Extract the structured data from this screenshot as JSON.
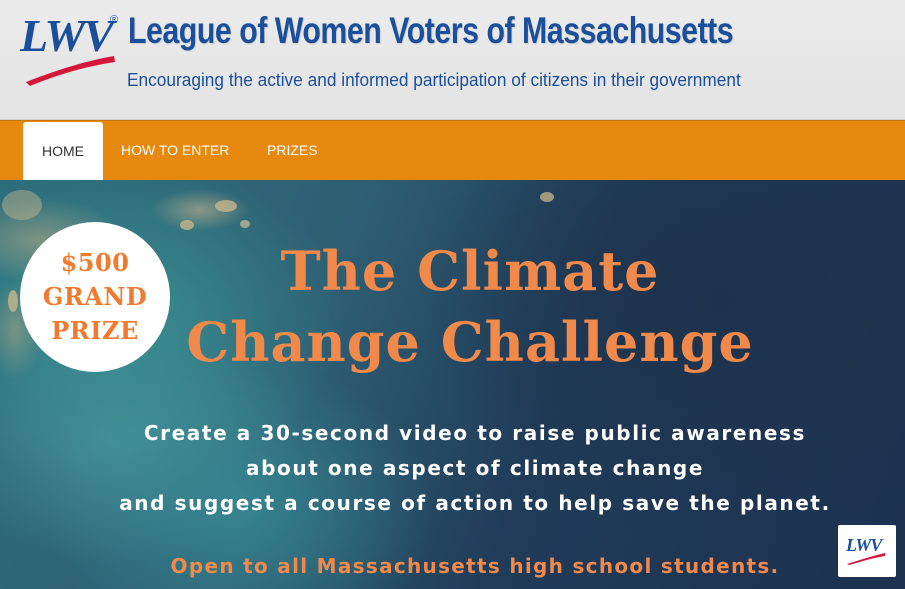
{
  "header": {
    "logo_text": "LWV",
    "logo_registered": "®",
    "title": "League of Women Voters of Massachusetts",
    "tagline": "Encouraging the active and informed participation of citizens in their government"
  },
  "nav": {
    "items": [
      {
        "label": "HOME",
        "active": true
      },
      {
        "label": "HOW TO ENTER",
        "active": false
      },
      {
        "label": "PRIZES",
        "active": false
      }
    ]
  },
  "hero": {
    "badge": {
      "line1": "$500",
      "line2": "GRAND",
      "line3": "PRIZE"
    },
    "title_line1": "The Climate",
    "title_line2": "Change Challenge",
    "desc_line1": "Create a 30-second video to raise public awareness",
    "desc_line2": "about one aspect of climate change",
    "desc_line3": "and suggest a course of action to help save the planet.",
    "open_line": "Open to all Massachusetts high school students.",
    "corner_logo_text": "LWV"
  },
  "colors": {
    "brand_blue": "#1b4f9c",
    "nav_orange": "#e6890e",
    "accent_orange": "#f0894a",
    "swoosh_red": "#d6173a"
  }
}
